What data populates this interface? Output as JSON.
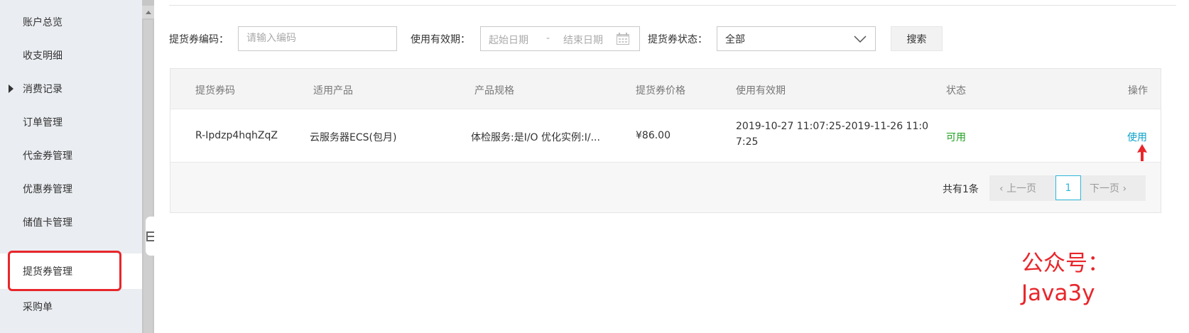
{
  "sidebar": {
    "items": [
      {
        "label": "账户总览"
      },
      {
        "label": "收支明细"
      },
      {
        "label": "消费记录"
      },
      {
        "label": "订单管理"
      },
      {
        "label": "代金券管理"
      },
      {
        "label": "优惠券管理"
      },
      {
        "label": "储值卡管理"
      },
      {
        "label": "提货券管理"
      },
      {
        "label": "采购单"
      }
    ],
    "active_item": "提货券管理"
  },
  "filters": {
    "code_label": "提货券编码：",
    "code_placeholder": "请输入编码",
    "validity_label": "使用有效期：",
    "start_placeholder": "起始日期",
    "separator": "-",
    "end_placeholder": "结束日期",
    "status_label": "提货券状态：",
    "status_value": "全部",
    "search_label": "搜索"
  },
  "table": {
    "headers": [
      "提货券码",
      "适用产品",
      "产品规格",
      "提货券价格",
      "使用有效期",
      "状态",
      "操作"
    ],
    "rows": [
      {
        "code": "R-Ipdzp4hqhZqZ",
        "product": "云服务器ECS(包月)",
        "spec": "体检服务:是I/O 优化实例:I/...",
        "price": "¥86.00",
        "validity_line1": "2019-10-27 11:07:25-2019-11-26 11:0",
        "validity_line2": "7:25",
        "status": "可用",
        "action": "使用"
      }
    ]
  },
  "pagination": {
    "total": "共有1条",
    "prev": "上一页",
    "current": "1",
    "next": "下一页"
  },
  "watermark": {
    "line1": "公众号：",
    "line2": "Java3y"
  },
  "colors": {
    "accent": "#2db8d9",
    "status_ok": "#1e9e1e",
    "highlight": "#e8262b"
  }
}
